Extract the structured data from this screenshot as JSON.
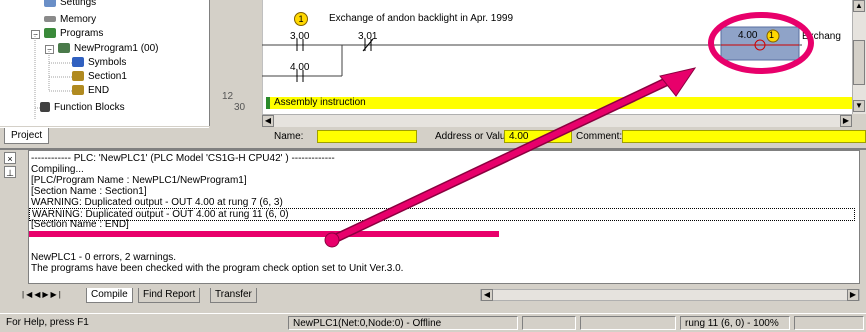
{
  "project_tree": {
    "items": [
      {
        "label": "Settings",
        "indent": 1
      },
      {
        "label": "Memory",
        "indent": 1
      },
      {
        "label": "Programs",
        "indent": 1
      },
      {
        "label": "NewProgram1 (00)",
        "indent": 2
      },
      {
        "label": "Symbols",
        "indent": 3
      },
      {
        "label": "Section1",
        "indent": 3
      },
      {
        "label": "END",
        "indent": 3
      },
      {
        "label": "Function Blocks",
        "indent": 1
      }
    ],
    "tab_label": "Project"
  },
  "ladder": {
    "rung_numbers": [
      "12",
      "30"
    ],
    "comment": "Exchange of andon backlight in Apr. 1999",
    "bookmark_number": "1",
    "contacts": [
      "3.00",
      "3.01",
      "4.00"
    ],
    "output_address": "4.00",
    "output_badge": "1",
    "output_comment_truncated": "Exchang",
    "section_label": "Assembly instruction",
    "colors": {
      "section_bar": "#ffff00",
      "highlight_ring": "#e8006b",
      "output_coil_bg": "#8fa3c8"
    }
  },
  "properties_bar": {
    "name_label": "Name:",
    "address_label": "Address or Value:",
    "address_value": "4.00",
    "comment_label": "Comment:"
  },
  "output": {
    "lines": [
      "------------ PLC: 'NewPLC1' (PLC Model 'CS1G-H CPU42' ) -------------",
      "Compiling...",
      "[PLC/Program Name : NewPLC1/NewProgram1]",
      "[Section Name : Section1]",
      "WARNING: Duplicated output -  OUT 4.00 at rung 7 (6, 3)",
      "WARNING: Duplicated output -  OUT 4.00 at rung 11 (6, 0)",
      "[Section Name : END]",
      "",
      "NewPLC1 - 0 errors, 2 warnings.",
      "The programs have been checked with the program check option set to Unit Ver.3.0."
    ],
    "tabs": [
      "Compile",
      "Find Report",
      "Transfer"
    ]
  },
  "status_bar": {
    "help": "For Help, press F1",
    "plc_status": "NewPLC1(Net:0,Node:0) - Offline",
    "rung_position": "rung 11 (6, 0)  - 100%"
  }
}
